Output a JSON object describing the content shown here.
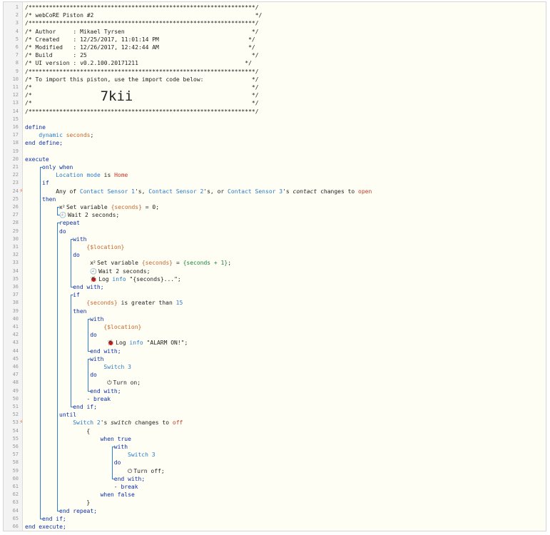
{
  "line_numbers": [
    "1",
    "2",
    "3",
    "4",
    "5",
    "6",
    "7",
    "8",
    "9",
    "10",
    "11",
    "12",
    "13",
    "14",
    "15",
    "16",
    "17",
    "18",
    "19",
    "20",
    "21",
    "22",
    "23",
    "24",
    "25",
    "26",
    "27",
    "28",
    "29",
    "30",
    "31",
    "32",
    "33",
    "34",
    "35",
    "36",
    "37",
    "38",
    "39",
    "40",
    "41",
    "42",
    "43",
    "44",
    "45",
    "46",
    "47",
    "48",
    "49",
    "50",
    "51",
    "52",
    "53",
    "54",
    "55",
    "56",
    "57",
    "58",
    "59",
    "60",
    "61",
    "62",
    "63",
    "64",
    "65",
    "66"
  ],
  "header": {
    "border": "/******************************************************************/",
    "title": "/* webCoRE Piston #2                                               */",
    "author": "/* Author     : Mikael Tyrsen                                     */",
    "created": "/* Created    : 12/25/2017, 11:01:14 PM                          */",
    "modified": "/* Modified   : 12/26/2017, 12:42:44 AM                          */",
    "build": "/* Build      : 25                                                */",
    "ui_version": "/* UI version : v0.2.100.20171211                               */",
    "import_note": "/* To import this piston, use the import code below:              */",
    "blank": "/*                                                                */",
    "import_code": "7kii"
  },
  "code": {
    "define": "define",
    "dynamic": "dynamic",
    "seconds_var": "seconds",
    "end_define": "end define;",
    "execute": "execute",
    "only_when": "only when",
    "location_mode": "Location mode",
    "is": " is ",
    "home": "Home",
    "if": "if",
    "any_of": "Any of ",
    "cs1": "Contact Sensor 1",
    "s_sep1": "'s, ",
    "cs2": "Contact Sensor 2",
    "s_sep2": "'s, or ",
    "cs3": "Contact Sensor 3",
    "s_sep3": "'s ",
    "contact": "contact",
    "changes_to": " changes to ",
    "open": "open",
    "then": "then",
    "set_variable": "Set variable ",
    "seconds_braced": "{seconds}",
    "eq_zero": " = 0;",
    "wait_2": "Wait 2 seconds;",
    "repeat": "repeat",
    "do": "do",
    "with": "with",
    "location_braced": "{$location}",
    "eq": " = ",
    "seconds_plus": "{seconds + 1}",
    "semicolon": ";",
    "log": "Log ",
    "info": "info",
    "log_msg1": " \"{seconds}...\";",
    "end_with": "end with;",
    "gt": " is greater than ",
    "fifteen": "15",
    "log_msg2": " \"ALARM ON!\";",
    "switch3": "Switch 3",
    "turn_on": "Turn on;",
    "break": "break",
    "end_if": "end if;",
    "until": "until",
    "switch2": "Switch 2",
    "switch_attr": "switch",
    "off": "off",
    "brace_open": "{",
    "when_true": "when true",
    "turn_off": "Turn off;",
    "when_false": "when false",
    "brace_close": "}",
    "end_repeat": "end repeat;",
    "end_execute": "end execute;"
  },
  "icons": {
    "variable": "x-squared-icon",
    "wait": "clock-icon",
    "log": "bug-icon",
    "power": "power-icon"
  }
}
